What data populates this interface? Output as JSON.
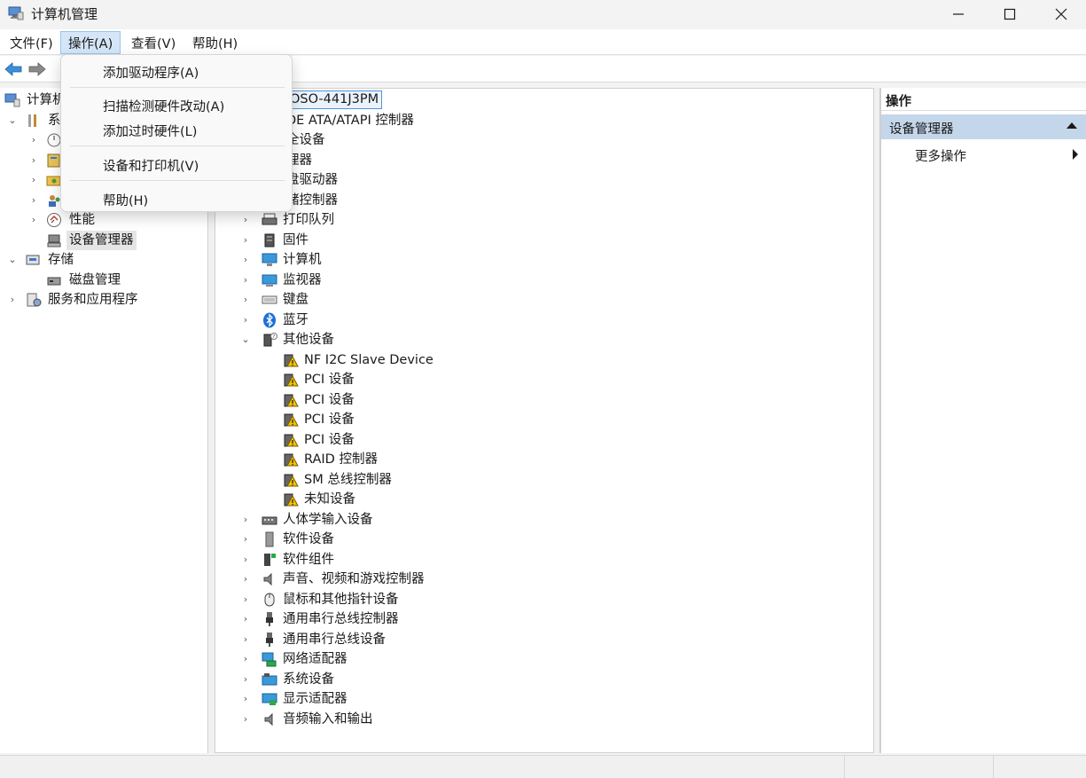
{
  "window": {
    "title": "计算机管理"
  },
  "menubar": {
    "items": [
      "文件(F)",
      "操作(A)",
      "查看(V)",
      "帮助(H)"
    ],
    "active": "操作(A)"
  },
  "dropdown": {
    "items": [
      "添加驱动程序(A)",
      "扫描检测硬件改动(A)",
      "添加过时硬件(L)",
      "设备和打印机(V)",
      "帮助(H)"
    ]
  },
  "left_tree": {
    "root": "计算机管理(本地)",
    "root_visible": "计算机",
    "system": "系",
    "performance": "性能",
    "device_manager": "设备管理器",
    "storage": "存储",
    "disk_management": "磁盘管理",
    "services": "服务和应用程序"
  },
  "device_tree": {
    "root": "OSO-441J3PM",
    "categories_top": [
      "DE ATA/ATAPI 控制器",
      "全设备",
      "理器",
      "盘驱动器",
      "储控制器"
    ],
    "categories": [
      "打印队列",
      "固件",
      "计算机",
      "监视器",
      "键盘",
      "蓝牙",
      "其他设备"
    ],
    "other_devices": [
      "NF I2C Slave Device",
      "PCI 设备",
      "PCI 设备",
      "PCI 设备",
      "PCI 设备",
      "RAID 控制器",
      "SM 总线控制器",
      "未知设备"
    ],
    "categories_after": [
      "人体学输入设备",
      "软件设备",
      "软件组件",
      "声音、视频和游戏控制器",
      "鼠标和其他指针设备",
      "通用串行总线控制器",
      "通用串行总线设备",
      "网络适配器",
      "系统设备",
      "显示适配器",
      "音频输入和输出"
    ]
  },
  "actions": {
    "header": "操作",
    "section": "设备管理器",
    "more": "更多操作"
  },
  "colors": {
    "accent": "#4e95d9",
    "section_bg": "#c4d6ea",
    "warning": "#f2c200"
  }
}
